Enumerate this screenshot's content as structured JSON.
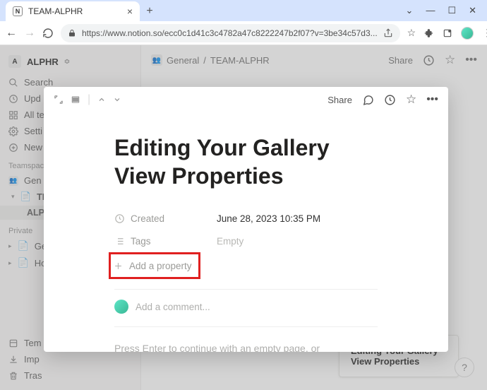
{
  "browser": {
    "tab_title": "TEAM-ALPHR",
    "url": "https://www.notion.so/ecc0c1d41c3c4782a47c8222247b2f07?v=3be34c57d3..."
  },
  "workspace": {
    "name": "ALPHR"
  },
  "sidebar": {
    "search": "Search",
    "updates": "Upd",
    "all_teamspaces": "All te",
    "settings": "Setti",
    "new_page": "New",
    "section_teamspaces": "Teamspace",
    "item_general": "Gen",
    "item_team": "TEA",
    "item_alphr": "ALP",
    "section_private": "Private",
    "item_get": "Ge",
    "item_home": "Ho",
    "templates": "Tem",
    "import": "Imp",
    "trash": "Tras"
  },
  "topbar": {
    "breadcrumb_general": "General",
    "breadcrumb_sep": "/",
    "breadcrumb_page": "TEAM-ALPHR",
    "share": "Share"
  },
  "modal": {
    "share": "Share",
    "title": "Editing Your Gallery View Properties",
    "props": {
      "created_label": "Created",
      "created_value": "June 28, 2023 10:35 PM",
      "tags_label": "Tags",
      "tags_value": "Empty"
    },
    "add_property": "Add a property",
    "comment_placeholder": "Add a comment...",
    "hint": "Press Enter to continue with an empty page, or"
  },
  "bottom_card": {
    "title": "Editing Your Gallery View Properties"
  },
  "help": "?"
}
